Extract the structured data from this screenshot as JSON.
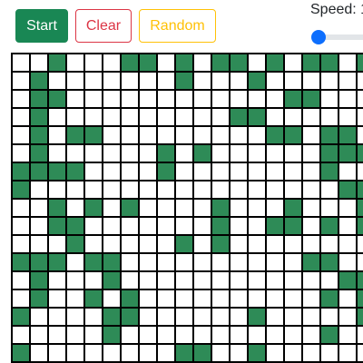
{
  "controls": {
    "start_label": "Start",
    "clear_label": "Clear",
    "random_label": "Random",
    "speed_label": "Speed: 1",
    "speed_value": 1
  },
  "colors": {
    "alive": "#2e8b57",
    "dead": "#ffffff",
    "grid_line": "#000000",
    "start_button": "#198754",
    "clear_button": "#dc3545",
    "random_button": "#ffc107",
    "slider_thumb": "#0d6efd"
  },
  "grid": {
    "rows": [
      "00100011010110101101",
      "01000000010001000000",
      "01100000000000011000",
      "01000000000011000000",
      "01011000000000110110",
      "01000000101000000111",
      "11110000100000000100",
      "10000000000000000011",
      "00101010000100010001",
      "00110000000100110101",
      "00010000010100000000",
      "11101100000000001100",
      "01000100000000000011",
      "01001010000000000101",
      "10000110000001000001",
      "00000100000000000100",
      "10000000011001000000"
    ]
  }
}
